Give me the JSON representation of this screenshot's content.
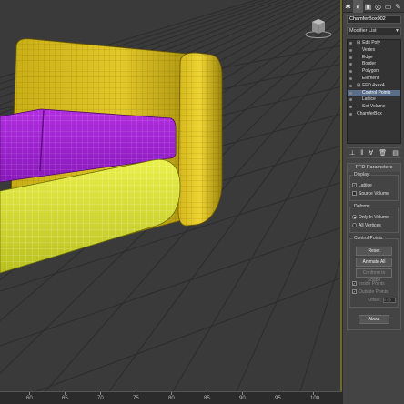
{
  "panel": {
    "object_name": "ChamferBox002",
    "modifier_list": "Modifier List",
    "stack": [
      {
        "label": "Edit Poly",
        "prefix": "⊟"
      },
      {
        "label": "Vertex",
        "prefix": ""
      },
      {
        "label": "Edge",
        "prefix": ""
      },
      {
        "label": "Border",
        "prefix": ""
      },
      {
        "label": "Polygon",
        "prefix": ""
      },
      {
        "label": "Element",
        "prefix": ""
      },
      {
        "label": "FFD 4x4x4",
        "prefix": "⊟"
      },
      {
        "label": "Control Points",
        "prefix": ""
      },
      {
        "label": "Lattice",
        "prefix": ""
      },
      {
        "label": "Set Volume",
        "prefix": ""
      },
      {
        "label": "ChamferBox",
        "prefix": ""
      }
    ],
    "ffd": {
      "title": "FFD Parameters",
      "display_label": "Display:",
      "lattice": "Lattice",
      "source_volume": "Source Volume",
      "deform_label": "Deform:",
      "only_in_volume": "Only In Volume",
      "all_vertices": "All Vertices",
      "control_points_label": "Control Points:",
      "reset": "Reset",
      "animate_all": "Animate All",
      "conform_to_shape": "Conform to Shape",
      "inside_points": "Inside Points",
      "outside_points": "Outside Points",
      "offset": "Offset:",
      "offset_value": "0.05",
      "about": "About"
    }
  },
  "timeline": {
    "ticks": [
      "60",
      "65",
      "70",
      "75",
      "80",
      "85",
      "90",
      "95",
      "100"
    ]
  },
  "colors": {
    "frame": "#d9c022",
    "cushion_top": "#a31fd6",
    "cushion_front": "#dde63a"
  }
}
